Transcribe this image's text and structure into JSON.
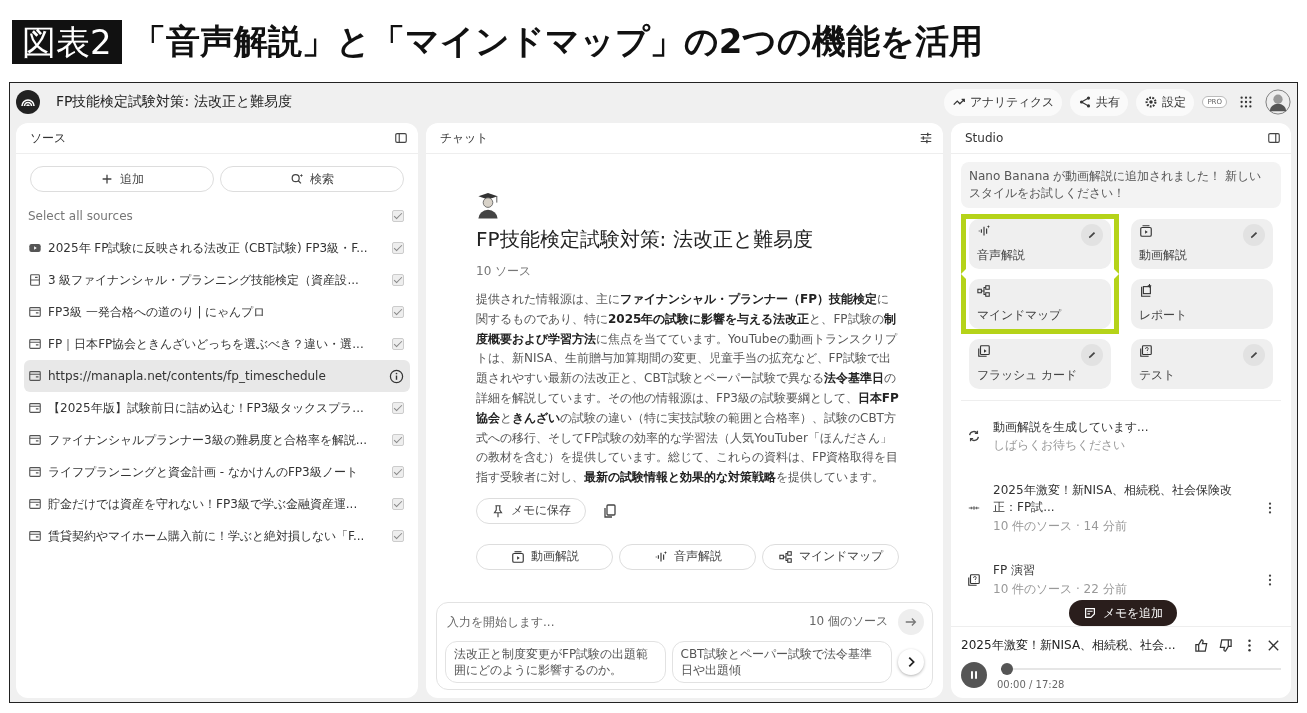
{
  "figure": {
    "label": "図表2",
    "caption": "「音声解説」と「マインドマップ」の2つの機能を活用"
  },
  "topbar": {
    "title": "FP技能検定試験対策: 法改正と難易度",
    "actions": [
      "アナリティクス",
      "共有",
      "設定"
    ],
    "badge": "PRO"
  },
  "sources": {
    "title": "ソース",
    "add": "追加",
    "search": "検索",
    "select_all": "Select all sources",
    "select_all_checked": true,
    "items": [
      {
        "kind": "video",
        "title": "2025年 FP試験に反映される法改正 (CBT試験) FP3級・F...",
        "selected": false,
        "checked": true
      },
      {
        "kind": "doc",
        "title": "3 級ファイナンシャル・プランニング技能検定（資産設...",
        "selected": false,
        "checked": true
      },
      {
        "kind": "web",
        "title": "FP3級 一発合格への道のり | にゃんプロ",
        "selected": false,
        "checked": true
      },
      {
        "kind": "web",
        "title": "FP｜日本FP協会ときんざいどっちを選ぶべき？違い・選...",
        "selected": false,
        "checked": true
      },
      {
        "kind": "web",
        "title": "https://manapla.net/contents/fp_timeschedule",
        "selected": true
      },
      {
        "kind": "web",
        "title": "【2025年版】試験前日に詰め込む！FP3級タックスプラ...",
        "selected": false,
        "checked": true
      },
      {
        "kind": "web",
        "title": "ファイナンシャルプランナー3級の難易度と合格率を解説...",
        "selected": false,
        "checked": true
      },
      {
        "kind": "web",
        "title": "ライフプランニングと資金計画 - なかけんのFP3級ノート",
        "selected": false,
        "checked": true
      },
      {
        "kind": "web",
        "title": "貯金だけでは資産を守れない！FP3級で学ぶ金融資産運...",
        "selected": false,
        "checked": true
      },
      {
        "kind": "web",
        "title": "賃貸契約やマイホーム購入前に！学ぶと絶対損しない「F...",
        "selected": false,
        "checked": true
      }
    ]
  },
  "chat": {
    "title": "チャット",
    "heading": "FP技能検定試験対策: 法改正と難易度",
    "count": "10 ソース",
    "summary": "提供された情報源は、主に**ファイナンシャル・プランナー（FP）技能検定**に関するものであり、特に**2025年の試験に影響を与える法改正**と、FP試験の**制度概要および学習方法**に焦点を当てています。YouTubeの動画トランスクリプトは、新NISA、生前贈与加算期間の変更、児童手当の拡充など、FP試験で出題されやすい最新の法改正と、CBT試験とペーパー試験で異なる**法令基準日**の詳細を解説しています。その他の情報源は、FP3級の試験要綱として、**日本FP協会**と**きんざい**の試験の違い（特に実技試験の範囲と合格率）、試験のCBT方式への移行、そしてFP試験の効率的な学習法（人気YouTuber「ほんださん」の教材を含む）を提供しています。総じて、これらの資料は、FP資格取得を目指す受験者に対し、**最新の試験情報と効果的な対策戦略**を提供しています。",
    "save": "メモに保存",
    "actions": [
      {
        "kind": "video",
        "label": "動画解説"
      },
      {
        "kind": "audio",
        "label": "音声解説"
      },
      {
        "kind": "mindmap",
        "label": "マインドマップ"
      }
    ],
    "input": {
      "placeholder": "入力を開始します...",
      "count": "10 個のソース"
    },
    "suggestions": [
      "法改正と制度変更がFP試験の出題範囲にどのように影響するのか。",
      "CBT試験とペーパー試験で法令基準日や出題傾"
    ]
  },
  "studio": {
    "title": "Studio",
    "notice": "Nano Banana が動画解説に追加されました！ 新しいスタイルをお試しください！",
    "tiles": [
      {
        "kind": "audio",
        "label": "音声解説",
        "editable": true,
        "highlighted": true
      },
      {
        "kind": "video",
        "label": "動画解説",
        "editable": true,
        "highlighted": false
      },
      {
        "kind": "mindmap",
        "label": "マインドマップ",
        "editable": false,
        "highlighted": true
      },
      {
        "kind": "report",
        "label": "レポート",
        "editable": false,
        "highlighted": false
      },
      {
        "kind": "flashcard",
        "label": "フラッシュ カード",
        "editable": true,
        "highlighted": false
      },
      {
        "kind": "quiz",
        "label": "テスト",
        "editable": true,
        "highlighted": false
      }
    ],
    "outputs": [
      {
        "kind": "loading",
        "title": "動画解説を生成しています...",
        "meta": "しばらくお待ちください"
      },
      {
        "kind": "audio",
        "title": "2025年激変！新NISA、相続税、社会保険改正：FP試...",
        "meta": "10 件のソース · 14 分前"
      },
      {
        "kind": "quiz",
        "title": "FP 演習",
        "meta": "10 件のソース · 22 分前"
      }
    ],
    "add_note": "メモを追加",
    "player": {
      "title": "2025年激変！新NISA、相続税、社会...",
      "time": "00:00 / 17:28",
      "level": 0.02
    }
  }
}
